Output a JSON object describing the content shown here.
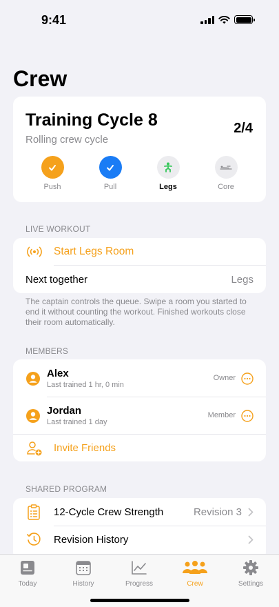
{
  "status": {
    "time": "9:41"
  },
  "page": {
    "title": "Crew"
  },
  "cycle": {
    "title": "Training Cycle 8",
    "subtitle": "Rolling crew cycle",
    "count": "2/4",
    "phases": [
      {
        "label": "Push",
        "state": "done",
        "color": "#f5a11c"
      },
      {
        "label": "Pull",
        "state": "done",
        "color": "#1a7cf5"
      },
      {
        "label": "Legs",
        "state": "current",
        "color": "#34c759"
      },
      {
        "label": "Core",
        "state": "pending",
        "color": "#8a8a8e"
      }
    ]
  },
  "live_workout": {
    "header": "LIVE WORKOUT",
    "start_label": "Start Legs Room",
    "next_label": "Next together",
    "next_value": "Legs",
    "note": "The captain controls the queue. Swipe a room you started to end it without counting the workout. Finished workouts close their room automatically."
  },
  "members": {
    "header": "MEMBERS",
    "list": [
      {
        "name": "Alex",
        "last_trained": "Last trained 1 hr, 0 min",
        "role": "Owner"
      },
      {
        "name": "Jordan",
        "last_trained": "Last trained 1 day",
        "role": "Member"
      }
    ],
    "invite_label": "Invite Friends"
  },
  "shared_program": {
    "header": "SHARED PROGRAM",
    "program_label": "12-Cycle Crew Strength",
    "program_value": "Revision 3",
    "history_label": "Revision History"
  },
  "tabs": [
    {
      "label": "Today",
      "active": false
    },
    {
      "label": "History",
      "active": false
    },
    {
      "label": "Progress",
      "active": false
    },
    {
      "label": "Crew",
      "active": true
    },
    {
      "label": "Settings",
      "active": false
    }
  ],
  "colors": {
    "accent": "#f5a11c",
    "blue": "#1a7cf5",
    "green": "#34c759"
  }
}
